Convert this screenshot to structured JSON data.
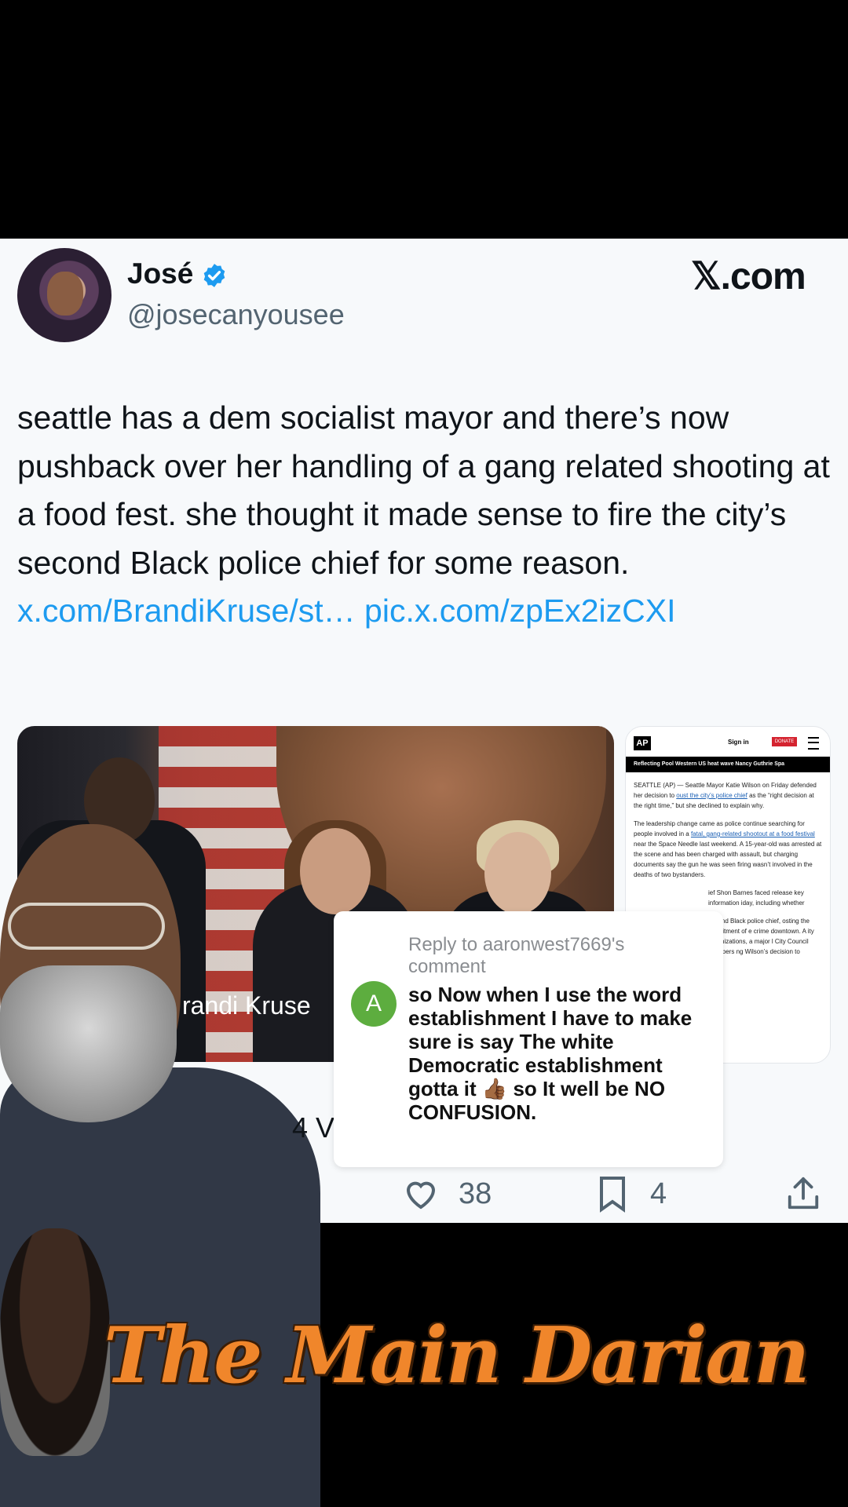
{
  "tweet": {
    "author_name": "José",
    "author_handle": "@josecanyousee",
    "site_logo": "𝕏.com",
    "text": "seattle has a dem socialist mayor and there’s now pushback over her handling of a gang related shooting at a food fest. she thought it made sense to fire the city’s second Black police chief for some reason.",
    "link_1": "x.com/BrandiKruse/st…",
    "link_2": "pic.x.com/zpEx2izCXI",
    "media_label": "randi Kruse",
    "views_partial": "4 V",
    "likes": "38",
    "bookmarks": "4"
  },
  "ap_article": {
    "logo": "AP",
    "signin": "Sign in",
    "donate": "DONATE",
    "nav": "Reflecting Pool   Western US heat wave   Nancy Guthrie   Spa",
    "p1a": "SEATTLE (AP) — Seattle Mayor Katie Wilson on Friday defended her decision to ",
    "p1link": "oust the city’s police chief",
    "p1b": " as the “right decision at the right time,” but she declined to explain why.",
    "p2a": "The leadership change came as police continue searching for people involved in a ",
    "p2link": "fatal, gang-related shootout at a food festival",
    "p2b": " near the Space Needle last weekend. A 15-year-old was arrested at the scene and has been charged with assault, but charging documents say the gun he was seen firing wasn’t involved in the deaths of two bystanders.",
    "p3": "ief Shon Barnes faced release key information iday, including whether",
    "p4": "second Black police chief, osting the recruitment of e crime downtown. A ity organizations, a major l City Council members ng Wilson’s decision to"
  },
  "comment": {
    "avatar_letter": "A",
    "reply_to": "Reply to aaronwest7669's comment",
    "text": "so Now when I use the word establishment I have to make sure is say The white Democratic establishment gotta it 👍🏾 so It well be NO CONFUSION."
  },
  "brand": {
    "title": "The Main Darian",
    "color": "#f0862b"
  },
  "colors": {
    "link": "#1d9bf0",
    "verified": "#1d9bf0",
    "muted": "#536471"
  }
}
